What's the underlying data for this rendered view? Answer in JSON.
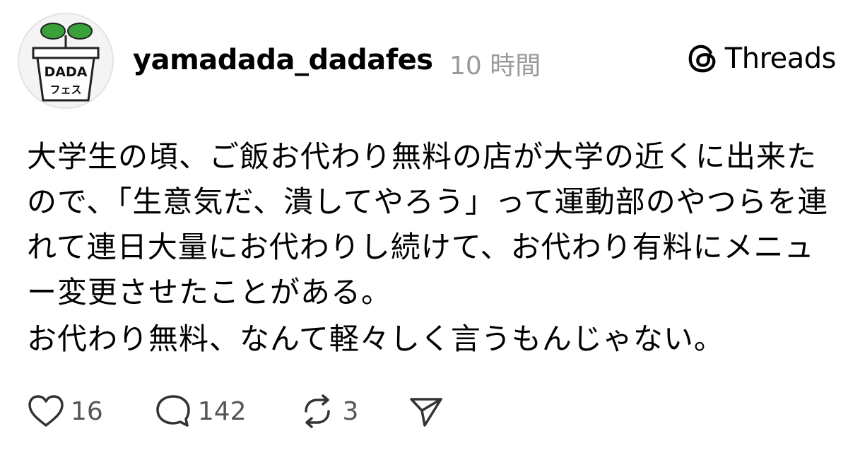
{
  "post": {
    "avatar_text_top": "DADA",
    "avatar_text_bottom": "フェス",
    "username": "yamadada_dadafes",
    "timestamp": "10 時間",
    "brand_label": "Threads",
    "paragraphs": [
      "大学生の頃、ご飯お代わり無料の店が大学の近くに出来たので、「生意気だ、潰してやろう」って運動部のやつらを連れて連日大量にお代わりし続けて、お代わり有料にメニュー変更させたことがある。",
      "お代わり無料、なんて軽々しく言うもんじゃない。"
    ],
    "actions": {
      "like_count": "16",
      "reply_count": "142",
      "repost_count": "3"
    }
  },
  "icons": {
    "like": "heart-icon",
    "reply": "speech-bubble-icon",
    "repost": "repost-arrows-icon",
    "share": "paper-plane-icon",
    "brand": "threads-logo-icon"
  }
}
